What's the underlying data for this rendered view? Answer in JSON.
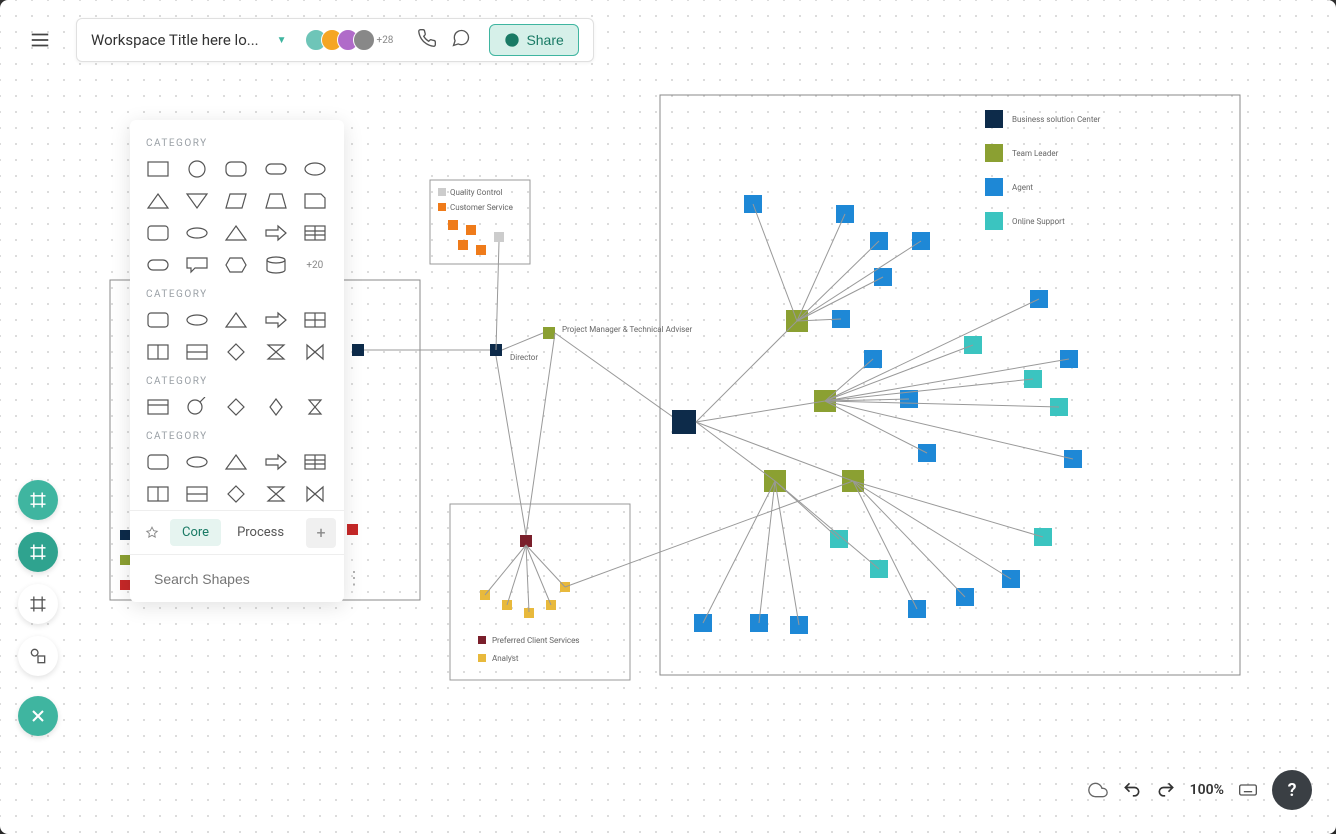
{
  "header": {
    "workspace_title": "Workspace Title here lo...",
    "avatar_more": "+28",
    "share_label": "Share"
  },
  "shapes_panel": {
    "category_label": "CATEGORY",
    "more_label": "+20",
    "tabs": {
      "core": "Core",
      "process": "Process"
    },
    "search_placeholder": "Search Shapes"
  },
  "bottom": {
    "zoom": "100%"
  },
  "diagram": {
    "legends": {
      "main": [
        {
          "color": "#0d2b4a",
          "label": "Business solution Center"
        },
        {
          "color": "#8ba032",
          "label": "Team Leader"
        },
        {
          "color": "#1e88d6",
          "label": "Agent"
        },
        {
          "color": "#3bc4c0",
          "label": "Online Support"
        }
      ],
      "topbox": [
        {
          "color": "#cccccc",
          "label": "Quality Control"
        },
        {
          "color": "#ef7b1a",
          "label": "Customer Service"
        }
      ],
      "bottombox": [
        {
          "color": "#7a1f2b",
          "label": "Preferred Client Services"
        },
        {
          "color": "#e8b93c",
          "label": "Analyst"
        }
      ]
    },
    "labels": {
      "project_mgr": "Project Manager & Technical Adviser",
      "director": "Director"
    }
  }
}
